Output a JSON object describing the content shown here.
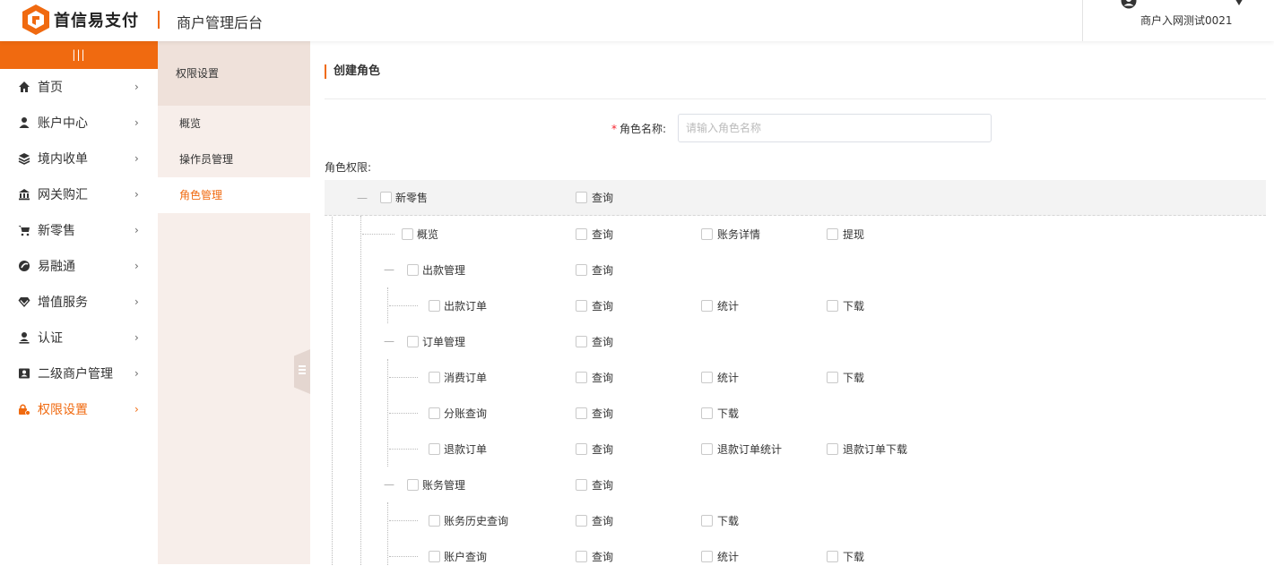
{
  "header": {
    "brand": "首信易支付",
    "title": "商户管理后台",
    "user_name": "商户入网测试0021"
  },
  "colors": {
    "accent": "#f06a10",
    "subnav_bg": "#f7eeea",
    "subnav_head_bg": "#efe1da",
    "tree_top_row": "#f3f3f3"
  },
  "sidebar": {
    "collapse_label": "|||",
    "items": [
      {
        "label": "首页",
        "icon": "home-icon"
      },
      {
        "label": "账户中心",
        "icon": "user-icon"
      },
      {
        "label": "境内收单",
        "icon": "layers-icon"
      },
      {
        "label": "网关购汇",
        "icon": "bank-icon"
      },
      {
        "label": "新零售",
        "icon": "cart-icon"
      },
      {
        "label": "易融通",
        "icon": "finance-icon"
      },
      {
        "label": "增值服务",
        "icon": "diamond-icon"
      },
      {
        "label": "认证",
        "icon": "person-icon"
      },
      {
        "label": "二级商户管理",
        "icon": "id-card-icon"
      },
      {
        "label": "权限设置",
        "icon": "lock-icon",
        "active": true
      }
    ],
    "chevron": "›"
  },
  "subnav": {
    "title": "权限设置",
    "items": [
      {
        "label": "概览"
      },
      {
        "label": "操作员管理"
      },
      {
        "label": "角色管理",
        "active": true
      }
    ]
  },
  "main": {
    "section_title": "创建角色",
    "role_name_label": "角色名称:",
    "role_name_required": "*",
    "role_name_placeholder": "请输入角色名称",
    "role_name_value": "",
    "permissions_label": "角色权限:",
    "tree": [
      {
        "label": "新零售",
        "perms": [
          "查询"
        ]
      },
      {
        "label": "概览",
        "perms": [
          "查询",
          "账务详情",
          "提现"
        ]
      },
      {
        "label": "出款管理",
        "perms": [
          "查询"
        ]
      },
      {
        "label": "出款订单",
        "perms": [
          "查询",
          "统计",
          "下载"
        ]
      },
      {
        "label": "订单管理",
        "perms": [
          "查询"
        ]
      },
      {
        "label": "消费订单",
        "perms": [
          "查询",
          "统计",
          "下载"
        ]
      },
      {
        "label": "分账查询",
        "perms": [
          "查询",
          "下载"
        ]
      },
      {
        "label": "退款订单",
        "perms": [
          "查询",
          "退款订单统计",
          "退款订单下载"
        ]
      },
      {
        "label": "账务管理",
        "perms": [
          "查询"
        ]
      },
      {
        "label": "账务历史查询",
        "perms": [
          "查询",
          "下载"
        ]
      },
      {
        "label": "账户查询",
        "perms": [
          "查询",
          "统计",
          "下载"
        ]
      }
    ]
  }
}
